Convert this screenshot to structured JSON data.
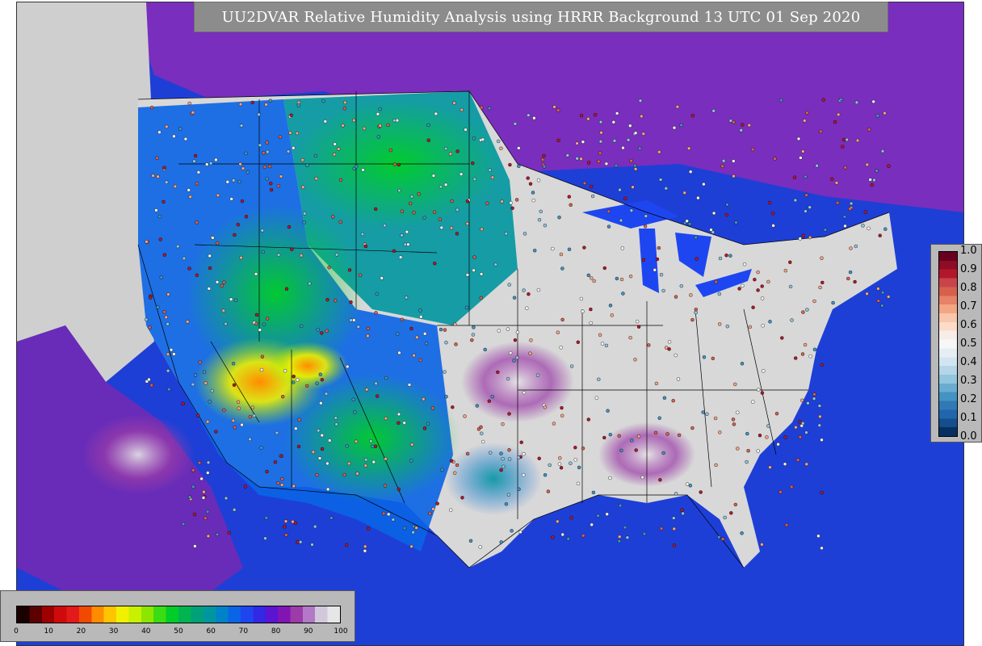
{
  "map": {
    "title": "UU2DVAR Relative Humidity Analysis using HRRR Background 13 UTC 01 Sep 2020",
    "background_color": "#cfcfcf",
    "land_fill_color": "#d8d8d8",
    "ocean_color": "#2235c8"
  },
  "rh_legend": {
    "tick_labels": [
      "0",
      "10",
      "20",
      "30",
      "40",
      "50",
      "60",
      "70",
      "80",
      "90",
      "100"
    ],
    "colors": [
      "#1a0000",
      "#5c0000",
      "#9e0000",
      "#cf0a0a",
      "#e31a1a",
      "#f04a00",
      "#ff8c00",
      "#ffc400",
      "#f0f000",
      "#c8f000",
      "#8ce600",
      "#3cdc14",
      "#00cd28",
      "#00b450",
      "#00a078",
      "#0096a0",
      "#0082c8",
      "#0a64e6",
      "#1e46f0",
      "#3228e6",
      "#5a14d2",
      "#8214b4",
      "#9b3ca8",
      "#b478c8",
      "#d2c8dc",
      "#e6e6e6"
    ]
  },
  "increment_legend": {
    "tick_labels": [
      "1.0",
      "0.9",
      "0.8",
      "0.7",
      "0.6",
      "0.5",
      "0.4",
      "0.3",
      "0.2",
      "0.1",
      "0.0"
    ],
    "colors": [
      "#67001f",
      "#8e0c25",
      "#b2182b",
      "#c9444a",
      "#d6604d",
      "#e58267",
      "#f4a582",
      "#f8c6ab",
      "#fddbc7",
      "#f7ede8",
      "#f7f7f7",
      "#e6eef3",
      "#d1e5f0",
      "#b4d6e8",
      "#92c5de",
      "#6aacd0",
      "#4393c3",
      "#3179b5",
      "#2166ac",
      "#154e8c",
      "#053061"
    ]
  }
}
